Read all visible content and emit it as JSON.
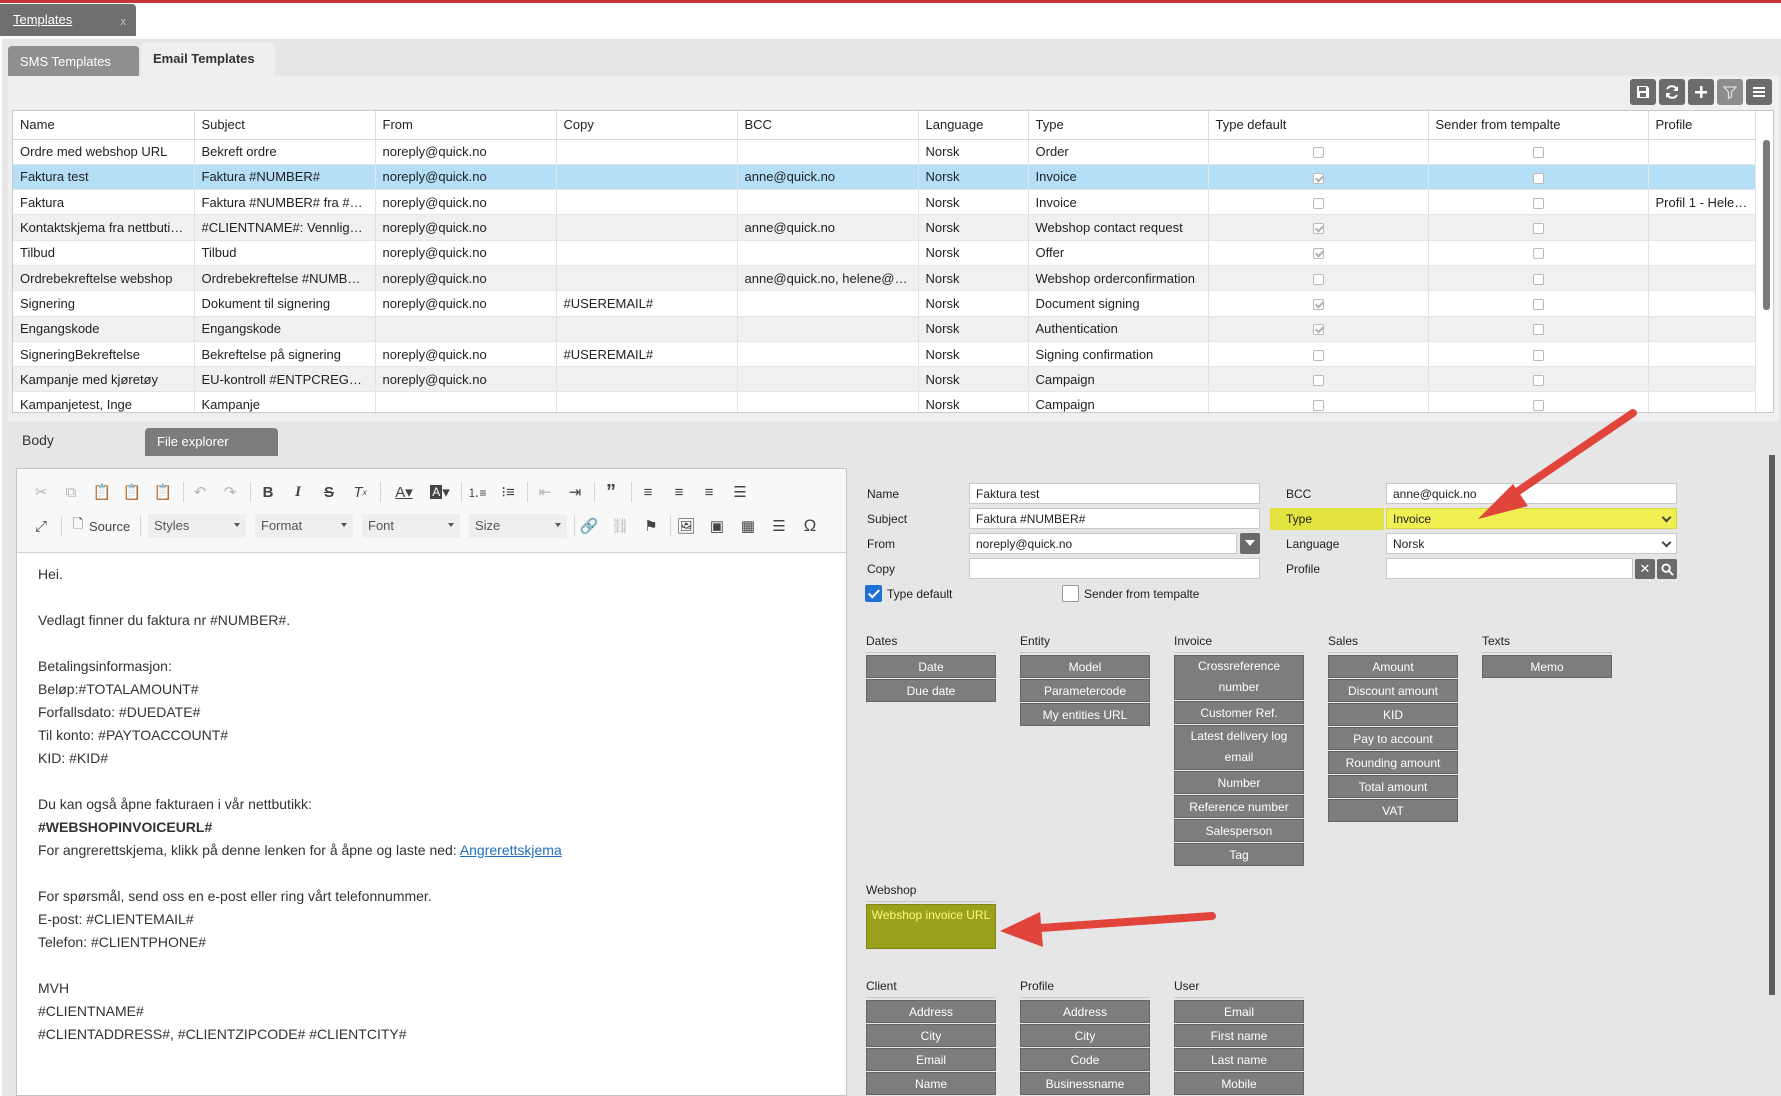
{
  "top_tab": {
    "label": "Templates",
    "close": "x"
  },
  "subtabs": {
    "sms": "SMS Templates",
    "email": "Email Templates"
  },
  "toolbar_icons": [
    "save-icon",
    "refresh-icon",
    "add-icon",
    "filter-icon",
    "menu-icon"
  ],
  "table": {
    "columns": [
      "Name",
      "Subject",
      "From",
      "Copy",
      "BCC",
      "Language",
      "Type",
      "Type default",
      "Sender from tempalte",
      "Profile"
    ],
    "rows": [
      {
        "name": "Ordre med webshop URL",
        "subject": "Bekreft ordre",
        "from": "noreply@quick.no",
        "copy": "",
        "bcc": "",
        "language": "Norsk",
        "type": "Order",
        "type_default": false,
        "sender": false,
        "profile": ""
      },
      {
        "name": "Faktura test",
        "subject": "Faktura #NUMBER#",
        "from": "noreply@quick.no",
        "copy": "",
        "bcc": "anne@quick.no",
        "language": "Norsk",
        "type": "Invoice",
        "type_default": true,
        "sender": false,
        "profile": "",
        "selected": true
      },
      {
        "name": "Faktura",
        "subject": "Faktura #NUMBER# fra #C…",
        "from": "noreply@quick.no",
        "copy": "",
        "bcc": "",
        "language": "Norsk",
        "type": "Invoice",
        "type_default": false,
        "sender": false,
        "profile": "Profil 1 - Helen…"
      },
      {
        "name": "Kontaktskjema fra nettbuti…",
        "subject": "#CLIENTNAME#: Vennligst…",
        "from": "noreply@quick.no",
        "copy": "",
        "bcc": "anne@quick.no",
        "language": "Norsk",
        "type": "Webshop contact request",
        "type_default": true,
        "sender": false,
        "profile": ""
      },
      {
        "name": "Tilbud",
        "subject": "Tilbud",
        "from": "noreply@quick.no",
        "copy": "",
        "bcc": "",
        "language": "Norsk",
        "type": "Offer",
        "type_default": true,
        "sender": false,
        "profile": ""
      },
      {
        "name": "Ordrebekreftelse webshop",
        "subject": "Ordrebekreftelse #NUMBE…",
        "from": "noreply@quick.no",
        "copy": "",
        "bcc": "anne@quick.no, helene@q…",
        "language": "Norsk",
        "type": "Webshop orderconfirmation",
        "type_default": false,
        "sender": false,
        "profile": ""
      },
      {
        "name": "Signering",
        "subject": "Dokument til signering",
        "from": "noreply@quick.no",
        "copy": "#USEREMAIL#",
        "bcc": "",
        "language": "Norsk",
        "type": "Document signing",
        "type_default": true,
        "sender": false,
        "profile": ""
      },
      {
        "name": "Engangskode",
        "subject": "Engangskode",
        "from": "",
        "copy": "",
        "bcc": "",
        "language": "Norsk",
        "type": "Authentication",
        "type_default": true,
        "sender": false,
        "profile": ""
      },
      {
        "name": "SigneringBekreftelse",
        "subject": "Bekreftelse på signering",
        "from": "noreply@quick.no",
        "copy": "#USEREMAIL#",
        "bcc": "",
        "language": "Norsk",
        "type": "Signing confirmation",
        "type_default": false,
        "sender": false,
        "profile": ""
      },
      {
        "name": "Kampanje med kjøretøy",
        "subject": "EU-kontroll #ENTPCREGNR#",
        "from": "noreply@quick.no",
        "copy": "",
        "bcc": "",
        "language": "Norsk",
        "type": "Campaign",
        "type_default": false,
        "sender": false,
        "profile": ""
      },
      {
        "name": "Kampanjetest, Inge",
        "subject": "Kampanje",
        "from": "",
        "copy": "",
        "bcc": "",
        "language": "Norsk",
        "type": "Campaign",
        "type_default": false,
        "sender": false,
        "profile": ""
      }
    ]
  },
  "lower_tabs": {
    "body": "Body",
    "file_explorer": "File explorer"
  },
  "editor": {
    "toolbar_labels": {
      "source": "Source",
      "styles": "Styles",
      "format": "Format",
      "font": "Font",
      "size": "Size"
    },
    "content": {
      "greeting": "Hei.",
      "attached": "Vedlagt finner du faktura nr #NUMBER#.",
      "payment_title": "Betalingsinformasjon:",
      "amount": "Beløp:#TOTALAMOUNT#",
      "due": "Forfallsdato: #DUEDATE#",
      "to_account": "Til konto: #PAYTOACCOUNT#",
      "kid": "KID: #KID#",
      "open_text": "Du kan også åpne fakturaen i vår nettbutikk:",
      "webshop_url": "#WEBSHOPINVOICEURL#",
      "withdraw_text": "For angrerettskjema, klikk på denne lenken for å åpne og laste ned: ",
      "withdraw_link": "Angrerettskjema",
      "questions": "For spørsmål, send oss en e-post eller ring vårt telefonnummer.",
      "email": "E-post: #CLIENTEMAIL#",
      "phone": "Telefon: #CLIENTPHONE#",
      "regards": "MVH",
      "clientname": "#CLIENTNAME#",
      "address": "#CLIENTADDRESS#, #CLIENTZIPCODE# #CLIENTCITY#"
    }
  },
  "form": {
    "name_label": "Name",
    "name_value": "Faktura test",
    "subject_label": "Subject",
    "subject_value": "Faktura #NUMBER#",
    "from_label": "From",
    "from_value": "noreply@quick.no",
    "copy_label": "Copy",
    "copy_value": "",
    "bcc_label": "BCC",
    "bcc_value": "anne@quick.no",
    "type_label": "Type",
    "type_value": "Invoice",
    "language_label": "Language",
    "language_value": "Norsk",
    "profile_label": "Profile",
    "profile_value": "",
    "type_default_label": "Type default",
    "type_default_checked": true,
    "sender_label": "Sender from tempalte",
    "sender_checked": false,
    "highlight_color": "#f1f052"
  },
  "tag_groups": {
    "dates": {
      "title": "Dates",
      "items": [
        "Date",
        "Due date"
      ]
    },
    "entity": {
      "title": "Entity",
      "items": [
        "Model",
        "Parametercode",
        "My entities URL"
      ]
    },
    "invoice": {
      "title": "Invoice",
      "items": [
        "Crossreference number",
        "Customer Ref.",
        "Latest delivery log email",
        "Number",
        "Reference number",
        "Salesperson",
        "Tag"
      ]
    },
    "sales": {
      "title": "Sales",
      "items": [
        "Amount",
        "Discount amount",
        "KID",
        "Pay to account",
        "Rounding amount",
        "Total amount",
        "VAT"
      ]
    },
    "texts": {
      "title": "Texts",
      "items": [
        "Memo"
      ]
    },
    "webshop": {
      "title": "Webshop",
      "items": [
        "Webshop invoice URL"
      ]
    },
    "client": {
      "title": "Client",
      "items": [
        "Address",
        "City",
        "Email",
        "Name"
      ]
    },
    "profile": {
      "title": "Profile",
      "items": [
        "Address",
        "City",
        "Code",
        "Businessname"
      ]
    },
    "user": {
      "title": "User",
      "items": [
        "Email",
        "First name",
        "Last name",
        "Mobile"
      ]
    }
  },
  "annotation_color": "#e0443a"
}
